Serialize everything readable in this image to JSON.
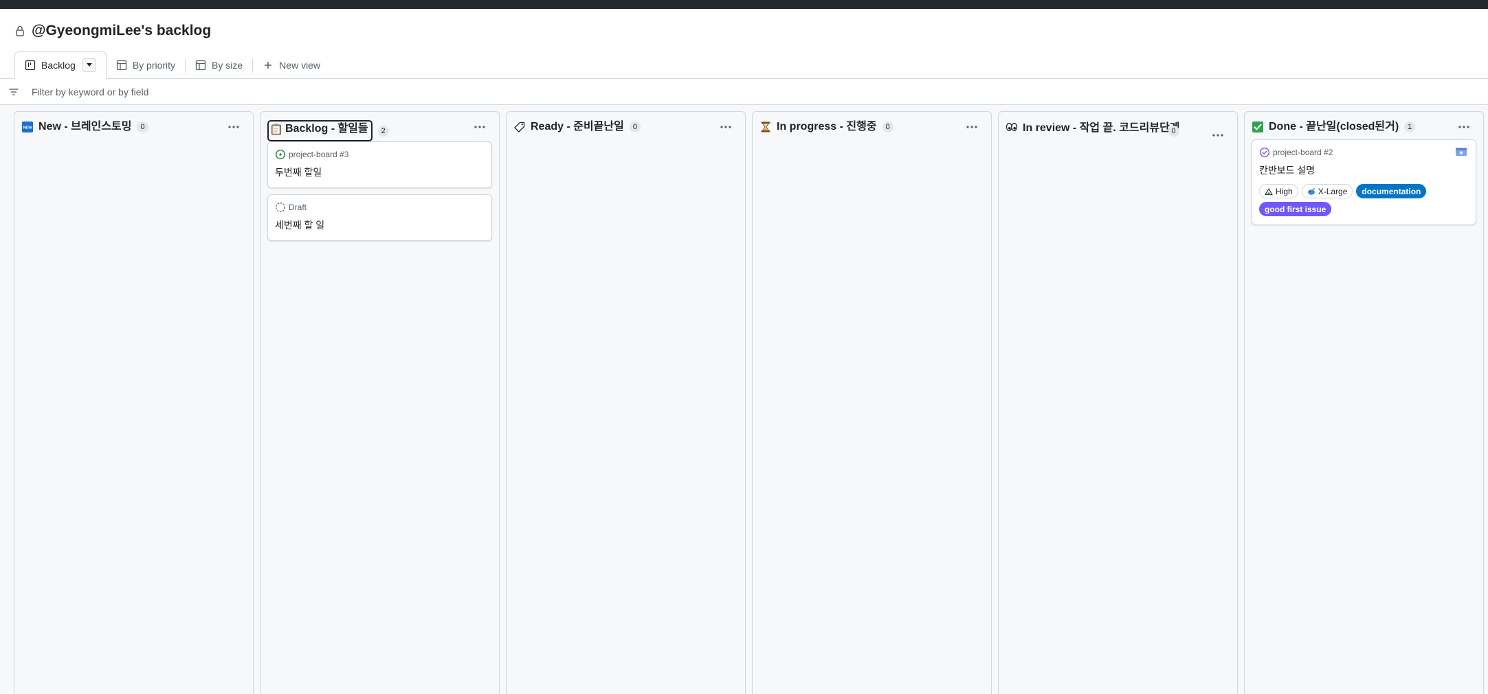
{
  "page": {
    "title": "@GyeongmiLee's backlog"
  },
  "tabs": [
    {
      "label": "Backlog",
      "icon": "board-icon",
      "active": true
    },
    {
      "label": "By priority",
      "icon": "table-icon"
    },
    {
      "label": "By size",
      "icon": "table-icon"
    },
    {
      "label": "New view",
      "icon": "plus-icon"
    }
  ],
  "filter": {
    "placeholder": "Filter by keyword or by field"
  },
  "columns": [
    {
      "title": "New - 브레인스토밍",
      "count": "0",
      "emoji": "new-emoji-icon"
    },
    {
      "title": "Backlog - 할일들",
      "count": "2",
      "emoji": "clipboard-emoji-icon",
      "cards": [
        {
          "meta": "project-board #3",
          "title": "두번째 할일",
          "status": "open-issue-icon"
        },
        {
          "meta": "Draft",
          "title": "세번째 할 일",
          "status": "draft-icon"
        }
      ]
    },
    {
      "title": "Ready - 준비끝난일",
      "count": "0",
      "emoji": "label-tag-emoji-icon"
    },
    {
      "title": "In progress - 진행중",
      "count": "0",
      "emoji": "hourglass-emoji-icon"
    },
    {
      "title": "In review - 작업 끝. 코드리뷰단계",
      "count": "0",
      "emoji": "eyes-emoji-icon"
    },
    {
      "title": "Done - 끝난일(closed된거)",
      "count": "1",
      "emoji": "check-emoji-icon",
      "cards": [
        {
          "meta": "project-board #2",
          "title": "칸반보드 설명",
          "status": "closed-issue-icon",
          "fields": [
            "High",
            "X-Large"
          ],
          "labels": [
            "documentation",
            "good first issue"
          ]
        }
      ]
    }
  ],
  "colors": {
    "label_documentation": "#0075ca",
    "label_good_first_issue": "#7057ff",
    "open_issue": "#1a7f37",
    "closed_issue": "#8250df"
  }
}
